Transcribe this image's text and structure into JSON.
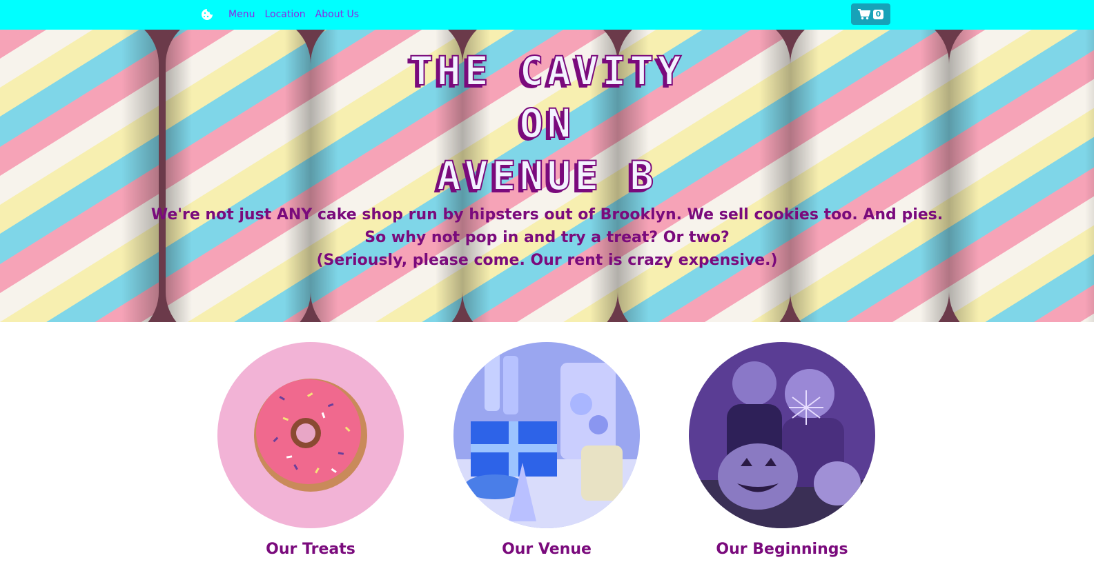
{
  "nav": {
    "links": [
      "Menu",
      "Location",
      "About Us"
    ],
    "cart_count": "0",
    "brand_icon": "cookie-icon",
    "cart_icon": "shopping-cart-icon"
  },
  "hero": {
    "title_lines": [
      "THE CAVITY",
      "ON",
      "AVENUE B"
    ],
    "tagline_lines": [
      "We're not just ANY cake shop run by hipsters out of Brooklyn. We sell cookies too. And pies.",
      "So why not pop in and try a treat? Or two?",
      "(Seriously, please come. Our rent is crazy expensive.)"
    ]
  },
  "features": [
    {
      "caption": "Our Treats",
      "image": "pink-donut-photo"
    },
    {
      "caption": "Our Venue",
      "image": "party-table-photo"
    },
    {
      "caption": "Our Beginnings",
      "image": "kids-halloween-pumpkin-photo"
    }
  ],
  "colors": {
    "navbar": "#00ffff",
    "nav_link": "#8a2be2",
    "cart_button": "#17a2b8",
    "heading": "#7a0a7c"
  }
}
